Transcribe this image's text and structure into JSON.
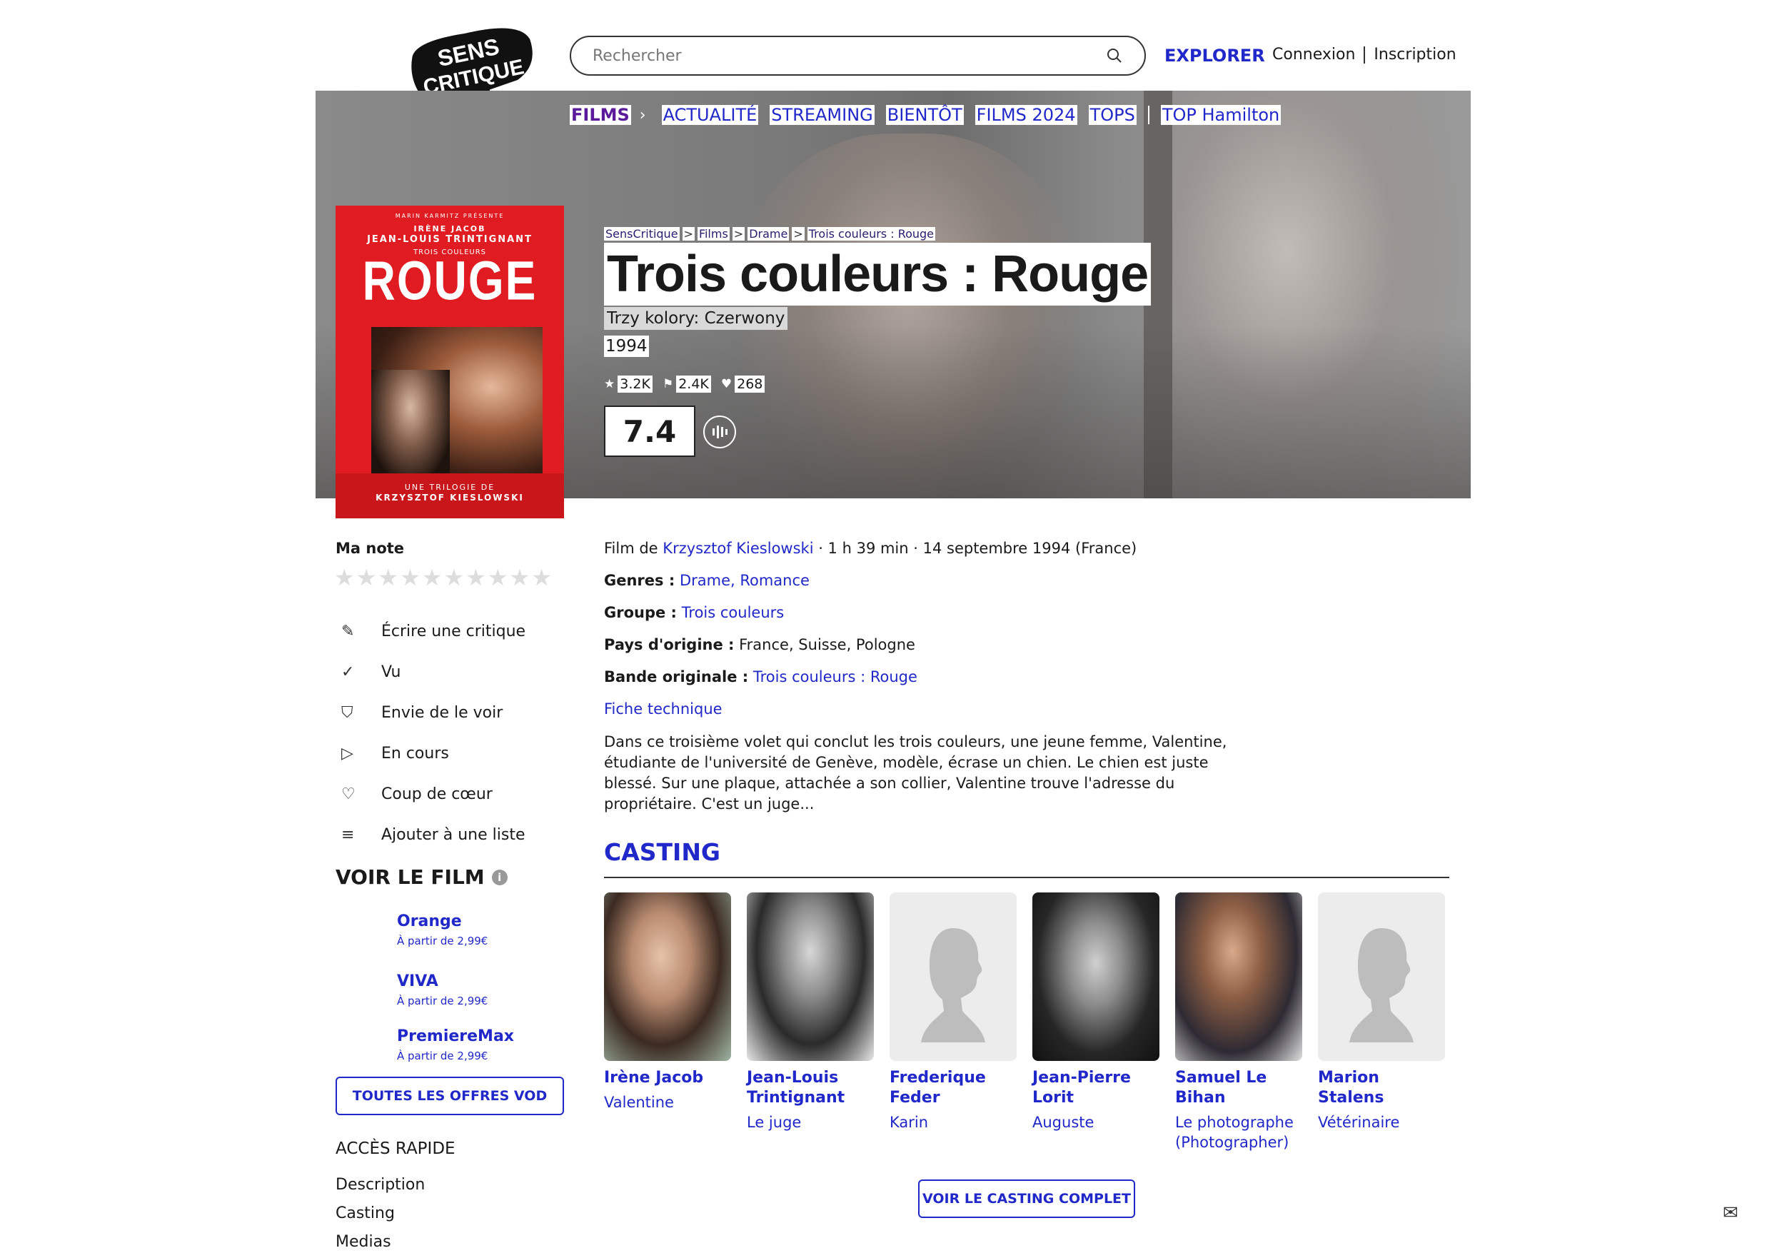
{
  "header": {
    "logo_line1": "SENS",
    "logo_line2": "CRITIQUE",
    "search_placeholder": "Rechercher",
    "explorer": "EXPLORER",
    "login": "Connexion",
    "signup": "Inscription"
  },
  "nav": {
    "items": [
      "FILMS",
      "ACTUALITÉ",
      "STREAMING",
      "BIENTÔT",
      "FILMS 2024",
      "TOPS",
      "TOP Hamilton"
    ]
  },
  "poster": {
    "presents": "MARIN KARMITZ PRÉSENTE",
    "actor1": "IRÈNE JACOB",
    "actor2": "JEAN-LOUIS TRINTIGNANT",
    "series": "TROIS COULEURS",
    "title": "ROUGE",
    "trilogy": "UNE TRILOGIE DE",
    "director": "KRZYSZTOF KIESLOWSKI"
  },
  "breadcrumb": [
    "SensCritique",
    "Films",
    "Drame",
    "Trois couleurs : Rouge"
  ],
  "movie": {
    "title": "Trois couleurs : Rouge",
    "original_title": "Trzy kolory: Czerwony",
    "year": "1994",
    "ratings_count": "3.2K",
    "wishlist_count": "2.4K",
    "favorites_count": "268",
    "score": "7.4"
  },
  "sidebar": {
    "my_rating_label": "Ma note",
    "star_count": 10,
    "actions": [
      {
        "icon": "pencil-icon",
        "glyph": "✎",
        "label": "Écrire une critique"
      },
      {
        "icon": "check-icon",
        "glyph": "✓",
        "label": "Vu"
      },
      {
        "icon": "bookmark-icon",
        "glyph": "⛉",
        "label": "Envie de le voir"
      },
      {
        "icon": "play-icon",
        "glyph": "▷",
        "label": "En cours"
      },
      {
        "icon": "heart-icon",
        "glyph": "♡",
        "label": "Coup de cœur"
      },
      {
        "icon": "list-add-icon",
        "glyph": "≡",
        "label": "Ajouter à une liste"
      }
    ],
    "watch_title": "VOIR LE FILM",
    "offers": [
      {
        "name": "Orange",
        "price": "À partir de 2,99€"
      },
      {
        "name": "VIVA",
        "price": "À partir de 2,99€"
      },
      {
        "name": "PremiereMax",
        "price": "À partir de 2,99€"
      }
    ],
    "all_offers": "TOUTES LES OFFRES VOD",
    "quick_access": "ACCÈS RAPIDE",
    "quick_links": [
      "Description",
      "Casting",
      "Medias"
    ]
  },
  "details": {
    "film_by": "Film de",
    "director": "Krzysztof Kieslowski",
    "meta": " · 1 h 39 min · 14 septembre 1994 (France)",
    "genres_label": "Genres :",
    "genres": "Drame, Romance",
    "group_label": "Groupe :",
    "group": "Trois couleurs",
    "country_label": "Pays d'origine :",
    "country": "France, Suisse, Pologne",
    "soundtrack_label": "Bande originale :",
    "soundtrack": "Trois couleurs : Rouge",
    "tech_sheet": "Fiche technique",
    "synopsis": "Dans ce troisième volet qui conclut les trois couleurs, une jeune femme, Valentine, étudiante de l'université de Genève, modèle, écrase un chien. Le chien est juste blessé. Sur une plaque, attachée a son collier, Valentine trouve l'adresse du propriétaire. C'est un juge..."
  },
  "casting": {
    "title": "CASTING",
    "actors": [
      {
        "name": "Irène Jacob",
        "role": "Valentine"
      },
      {
        "name": "Jean-Louis Trintignant",
        "role": "Le juge"
      },
      {
        "name": "Frederique Feder",
        "role": "Karin"
      },
      {
        "name": "Jean-Pierre Lorit",
        "role": "Auguste"
      },
      {
        "name": "Samuel Le Bihan",
        "role": "Le photographe (Photographer)"
      },
      {
        "name": "Marion Stalens",
        "role": "Vétérinaire"
      }
    ],
    "full_cast": "VOIR LE CASTING COMPLET"
  },
  "colors": {
    "accent": "#2128c9",
    "poster_red": "#e01c22"
  }
}
